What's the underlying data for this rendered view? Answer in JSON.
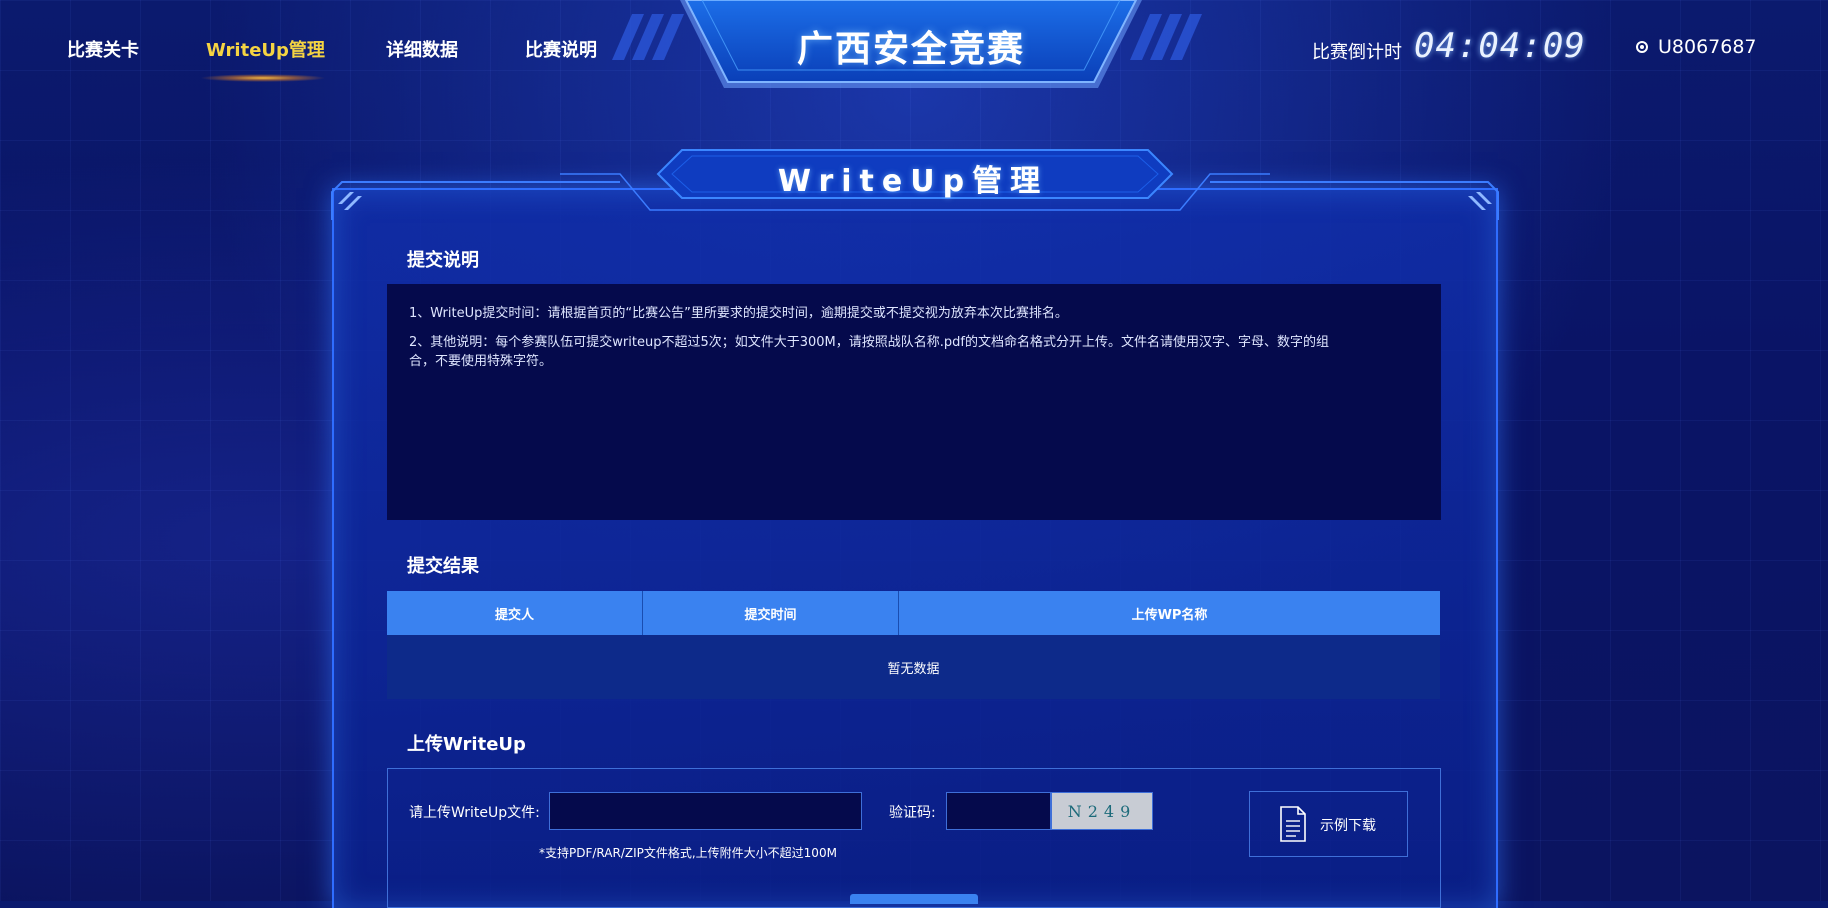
{
  "nav": {
    "items": [
      {
        "label": "比赛关卡"
      },
      {
        "label": "WriteUp管理"
      },
      {
        "label": "详细数据"
      },
      {
        "label": "比赛说明"
      }
    ]
  },
  "header": {
    "title": "广西安全竞赛",
    "countdown_label": "比赛倒计时",
    "countdown_value": "04:04:09",
    "user_id": "U8067687"
  },
  "panel": {
    "title": "WriteUp管理",
    "notice": {
      "heading": "提交说明",
      "items": [
        "1、WriteUp提交时间：请根据首页的“比赛公告”里所要求的提交时间，逾期提交或不提交视为放弃本次比赛排名。",
        "2、其他说明：每个参赛队伍可提交writeup不超过5次；如文件大于300M，请按照战队名称.pdf的文档命名格式分开上传。文件名请使用汉字、字母、数字的组合，不要使用特殊字符。"
      ]
    },
    "results": {
      "heading": "提交结果",
      "columns": [
        "提交人",
        "提交时间",
        "上传WP名称"
      ],
      "empty_text": "暂无数据"
    },
    "upload": {
      "heading": "上传WriteUp",
      "file_label": "请上传WriteUp文件:",
      "captcha_label": "验证码:",
      "captcha_text": "N249",
      "hint": "*支持PDF/RAR/ZIP文件格式,上传附件大小不超过100M",
      "sample_label": "示例下载"
    }
  },
  "colors": {
    "accent": "#3a82f0",
    "active_nav": "#f5d442",
    "background": "#0a1466",
    "box_dark": "#050a4c"
  }
}
